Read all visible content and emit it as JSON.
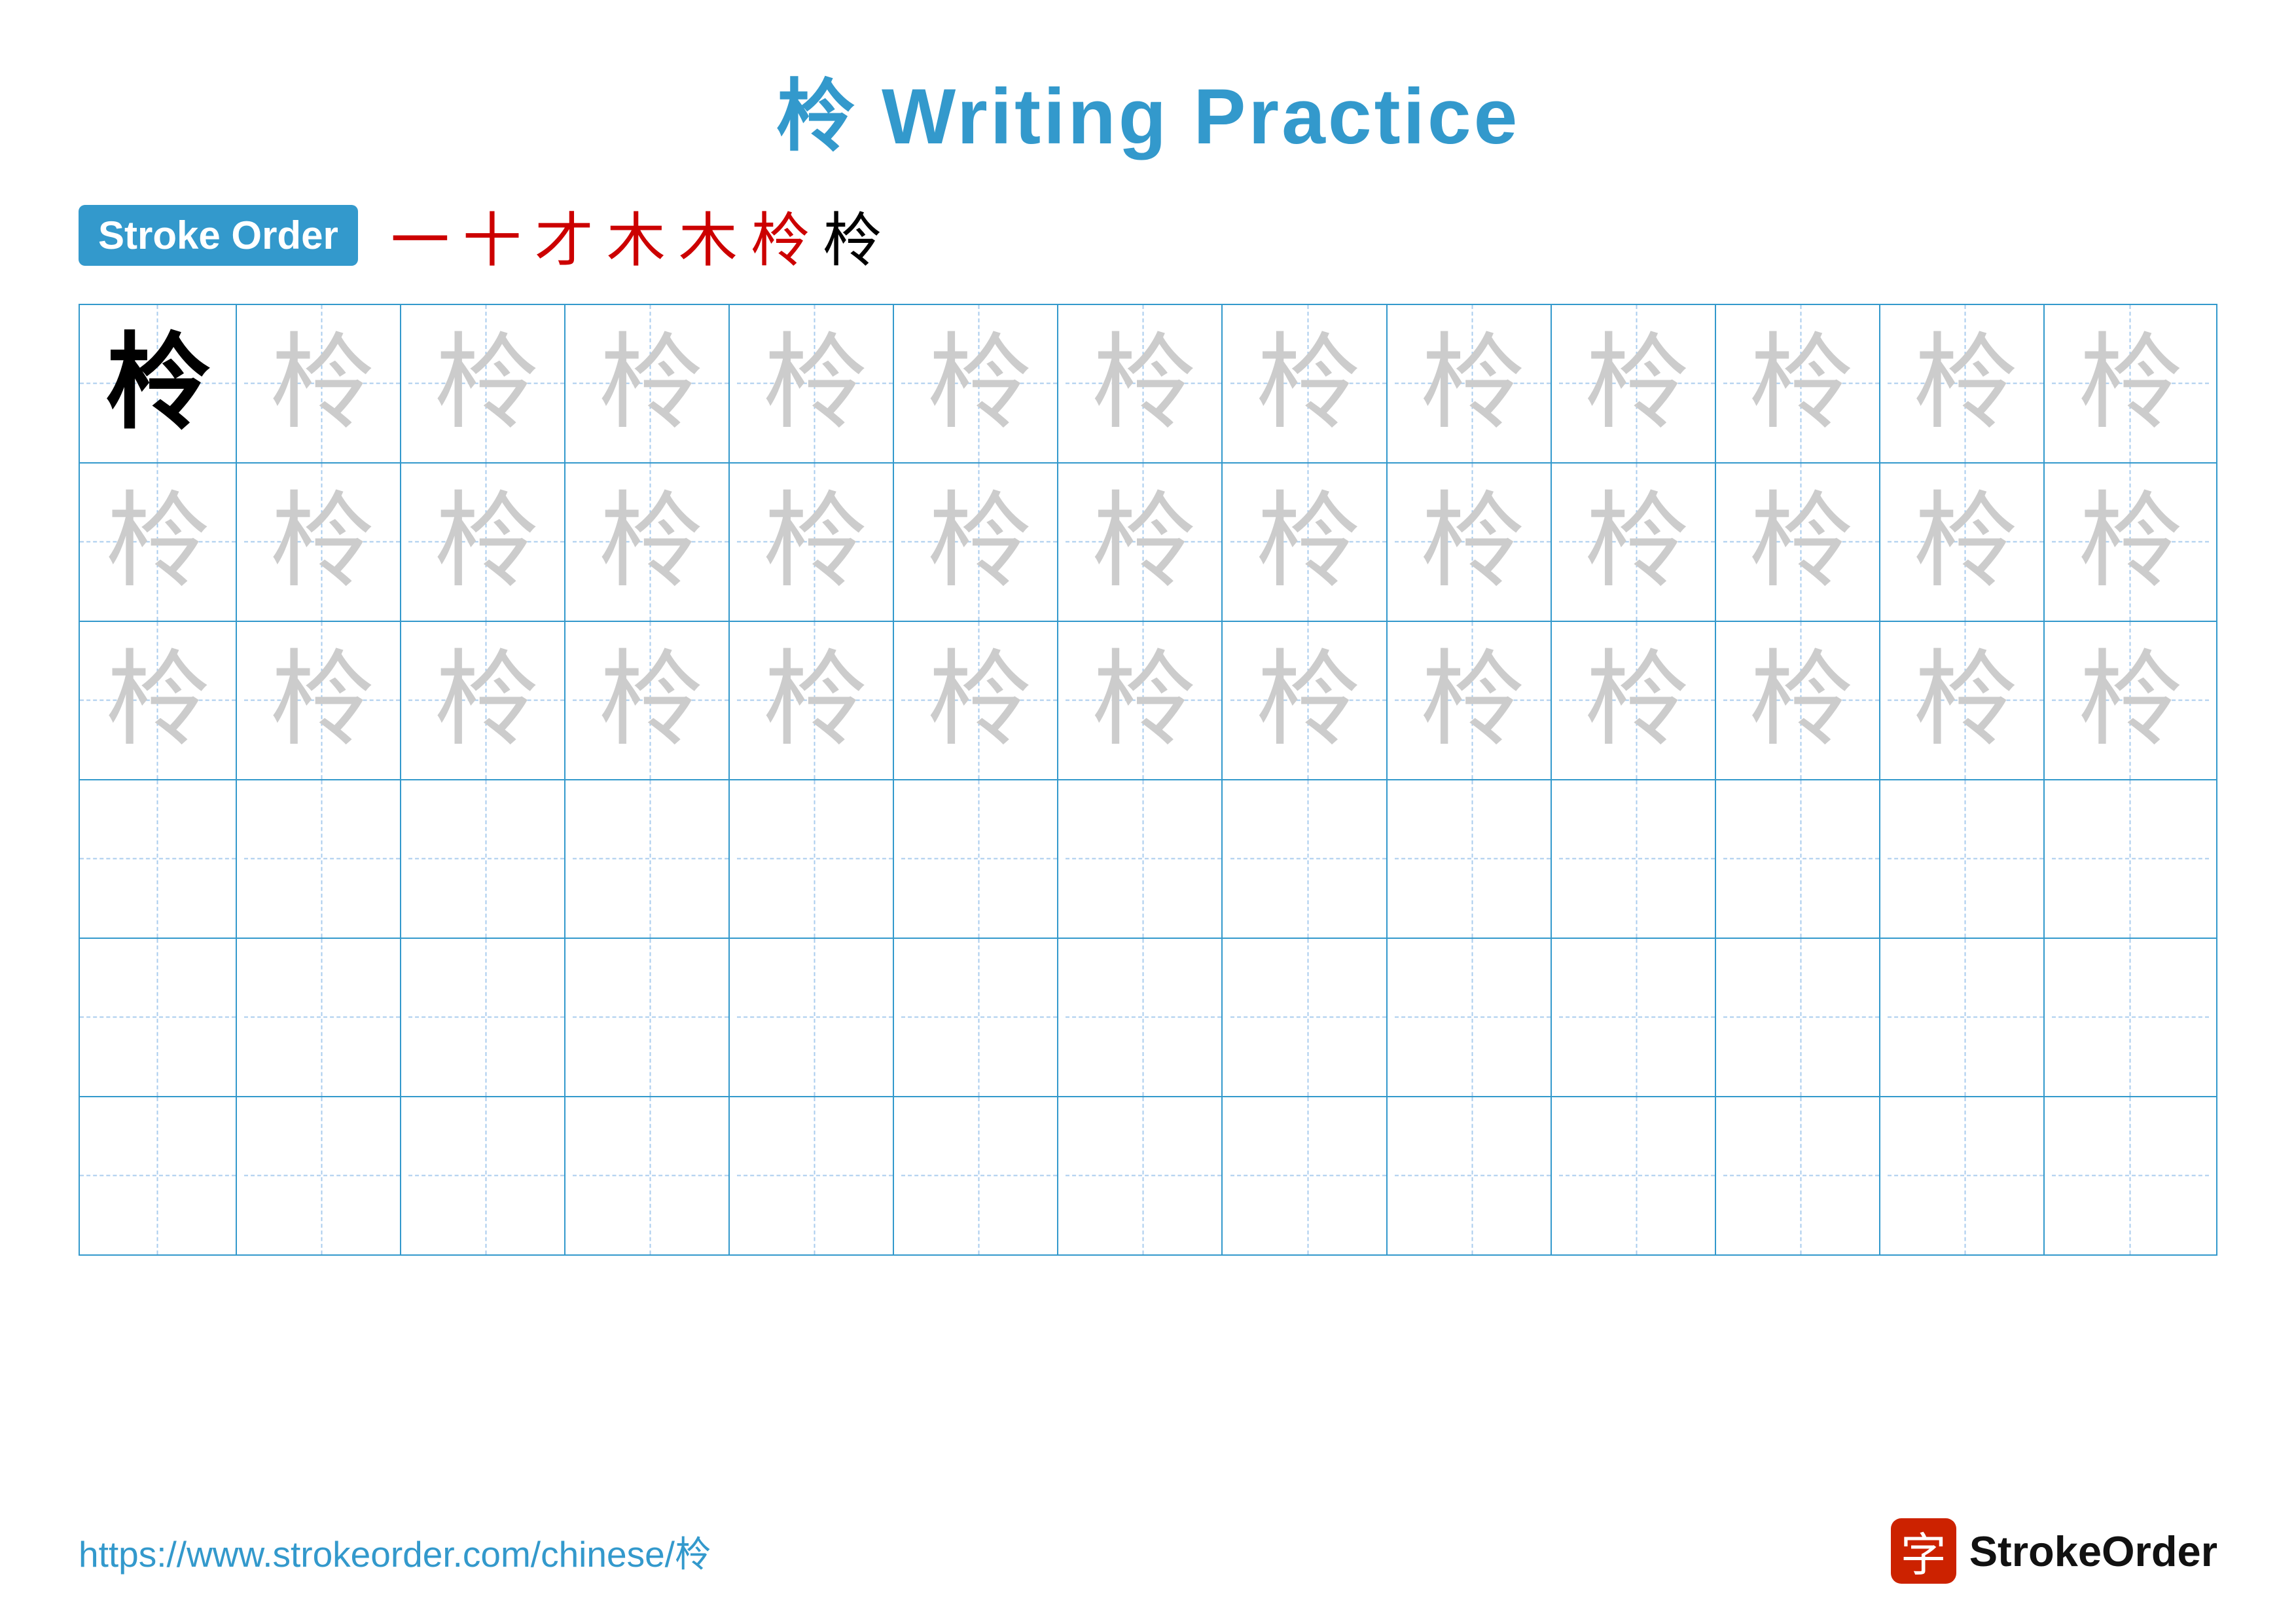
{
  "title": "柃 Writing Practice",
  "stroke_order_label": "Stroke Order",
  "stroke_sequence": [
    "一",
    "十",
    "才",
    "木",
    "木",
    "柃",
    "柃"
  ],
  "character": "柃",
  "grid": {
    "rows": 6,
    "cols": 13,
    "row_types": [
      "primary_guide",
      "guide",
      "guide",
      "empty",
      "empty",
      "empty"
    ]
  },
  "footer": {
    "url": "https://www.strokeorder.com/chinese/柃",
    "logo_icon": "字",
    "logo_text": "StrokeOrder"
  }
}
